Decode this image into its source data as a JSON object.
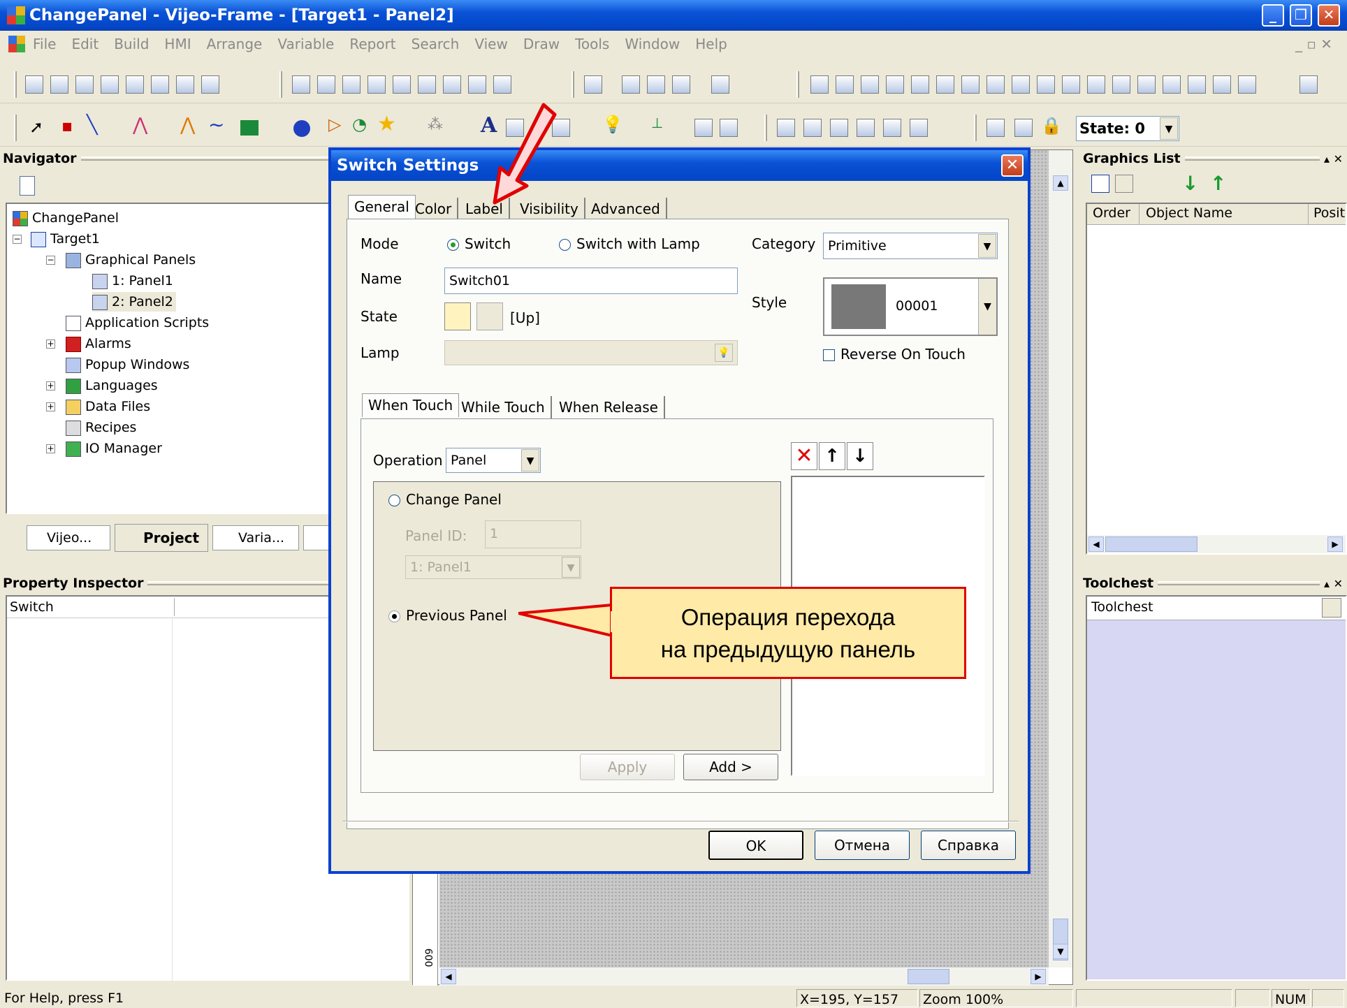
{
  "window": {
    "title": "ChangePanel - Vijeo-Frame - [Target1 - Panel2]"
  },
  "menu": [
    "File",
    "Edit",
    "Build",
    "HMI",
    "Arrange",
    "Variable",
    "Report",
    "Search",
    "View",
    "Draw",
    "Tools",
    "Window",
    "Help"
  ],
  "toolbar": {
    "state_label": "State: 0"
  },
  "navigator": {
    "title": "Navigator",
    "tree": [
      {
        "label": "ChangePanel"
      },
      {
        "label": "Target1"
      },
      {
        "label": "Graphical Panels"
      },
      {
        "label": "1: Panel1"
      },
      {
        "label": "2: Panel2"
      },
      {
        "label": "Application Scripts"
      },
      {
        "label": "Alarms"
      },
      {
        "label": "Popup Windows"
      },
      {
        "label": "Languages"
      },
      {
        "label": "Data Files"
      },
      {
        "label": "Recipes"
      },
      {
        "label": "IO Manager"
      }
    ],
    "tabs": [
      "Vijeo...",
      "Project",
      "Varia..."
    ]
  },
  "property_inspector": {
    "title": "Property Inspector",
    "object": "Switch"
  },
  "graphics_list": {
    "title": "Graphics List",
    "col_order": "Order",
    "col_name": "Object Name",
    "col_pos": "Posit"
  },
  "toolchest": {
    "title": "Toolchest",
    "selector": "Toolchest"
  },
  "dialog": {
    "title": "Switch Settings",
    "tabs": [
      "General",
      "Color",
      "Label",
      "Visibility",
      "Advanced"
    ],
    "mode_label": "Mode",
    "mode_switch": "Switch",
    "mode_switch_lamp": "Switch with Lamp",
    "category_label": "Category",
    "category_value": "Primitive",
    "name_label": "Name",
    "name_value": "Switch01",
    "style_label": "Style",
    "style_value": "00001",
    "state_label": "State",
    "state_value": "[Up]",
    "lamp_label": "Lamp",
    "reverse_label": "Reverse On Touch",
    "sub_tabs": [
      "When Touch",
      "While Touch",
      "When Release"
    ],
    "operation_label": "Operation",
    "operation_value": "Panel",
    "change_panel": "Change Panel",
    "panel_id_label": "Panel ID:",
    "panel_id_value": "1",
    "panel_select": "1: Panel1",
    "previous_panel": "Previous Panel",
    "apply": "Apply",
    "add": "Add >",
    "ok": "OK",
    "cancel": "Отмена",
    "help": "Справка"
  },
  "callout": {
    "line1": "Операция перехода",
    "line2": "на предыдущую панель"
  },
  "ruler_value": "600",
  "status": {
    "help": "For Help, press F1",
    "coords": "X=195, Y=157",
    "zoom": "Zoom 100%",
    "num": "NUM"
  },
  "colors": {
    "titlebar": "#0a52d6",
    "callout_bg": "#ffeaa7",
    "callout_border": "#e00000",
    "arrow": "#e00000",
    "toolchest_bg": "#d7d7f4"
  }
}
